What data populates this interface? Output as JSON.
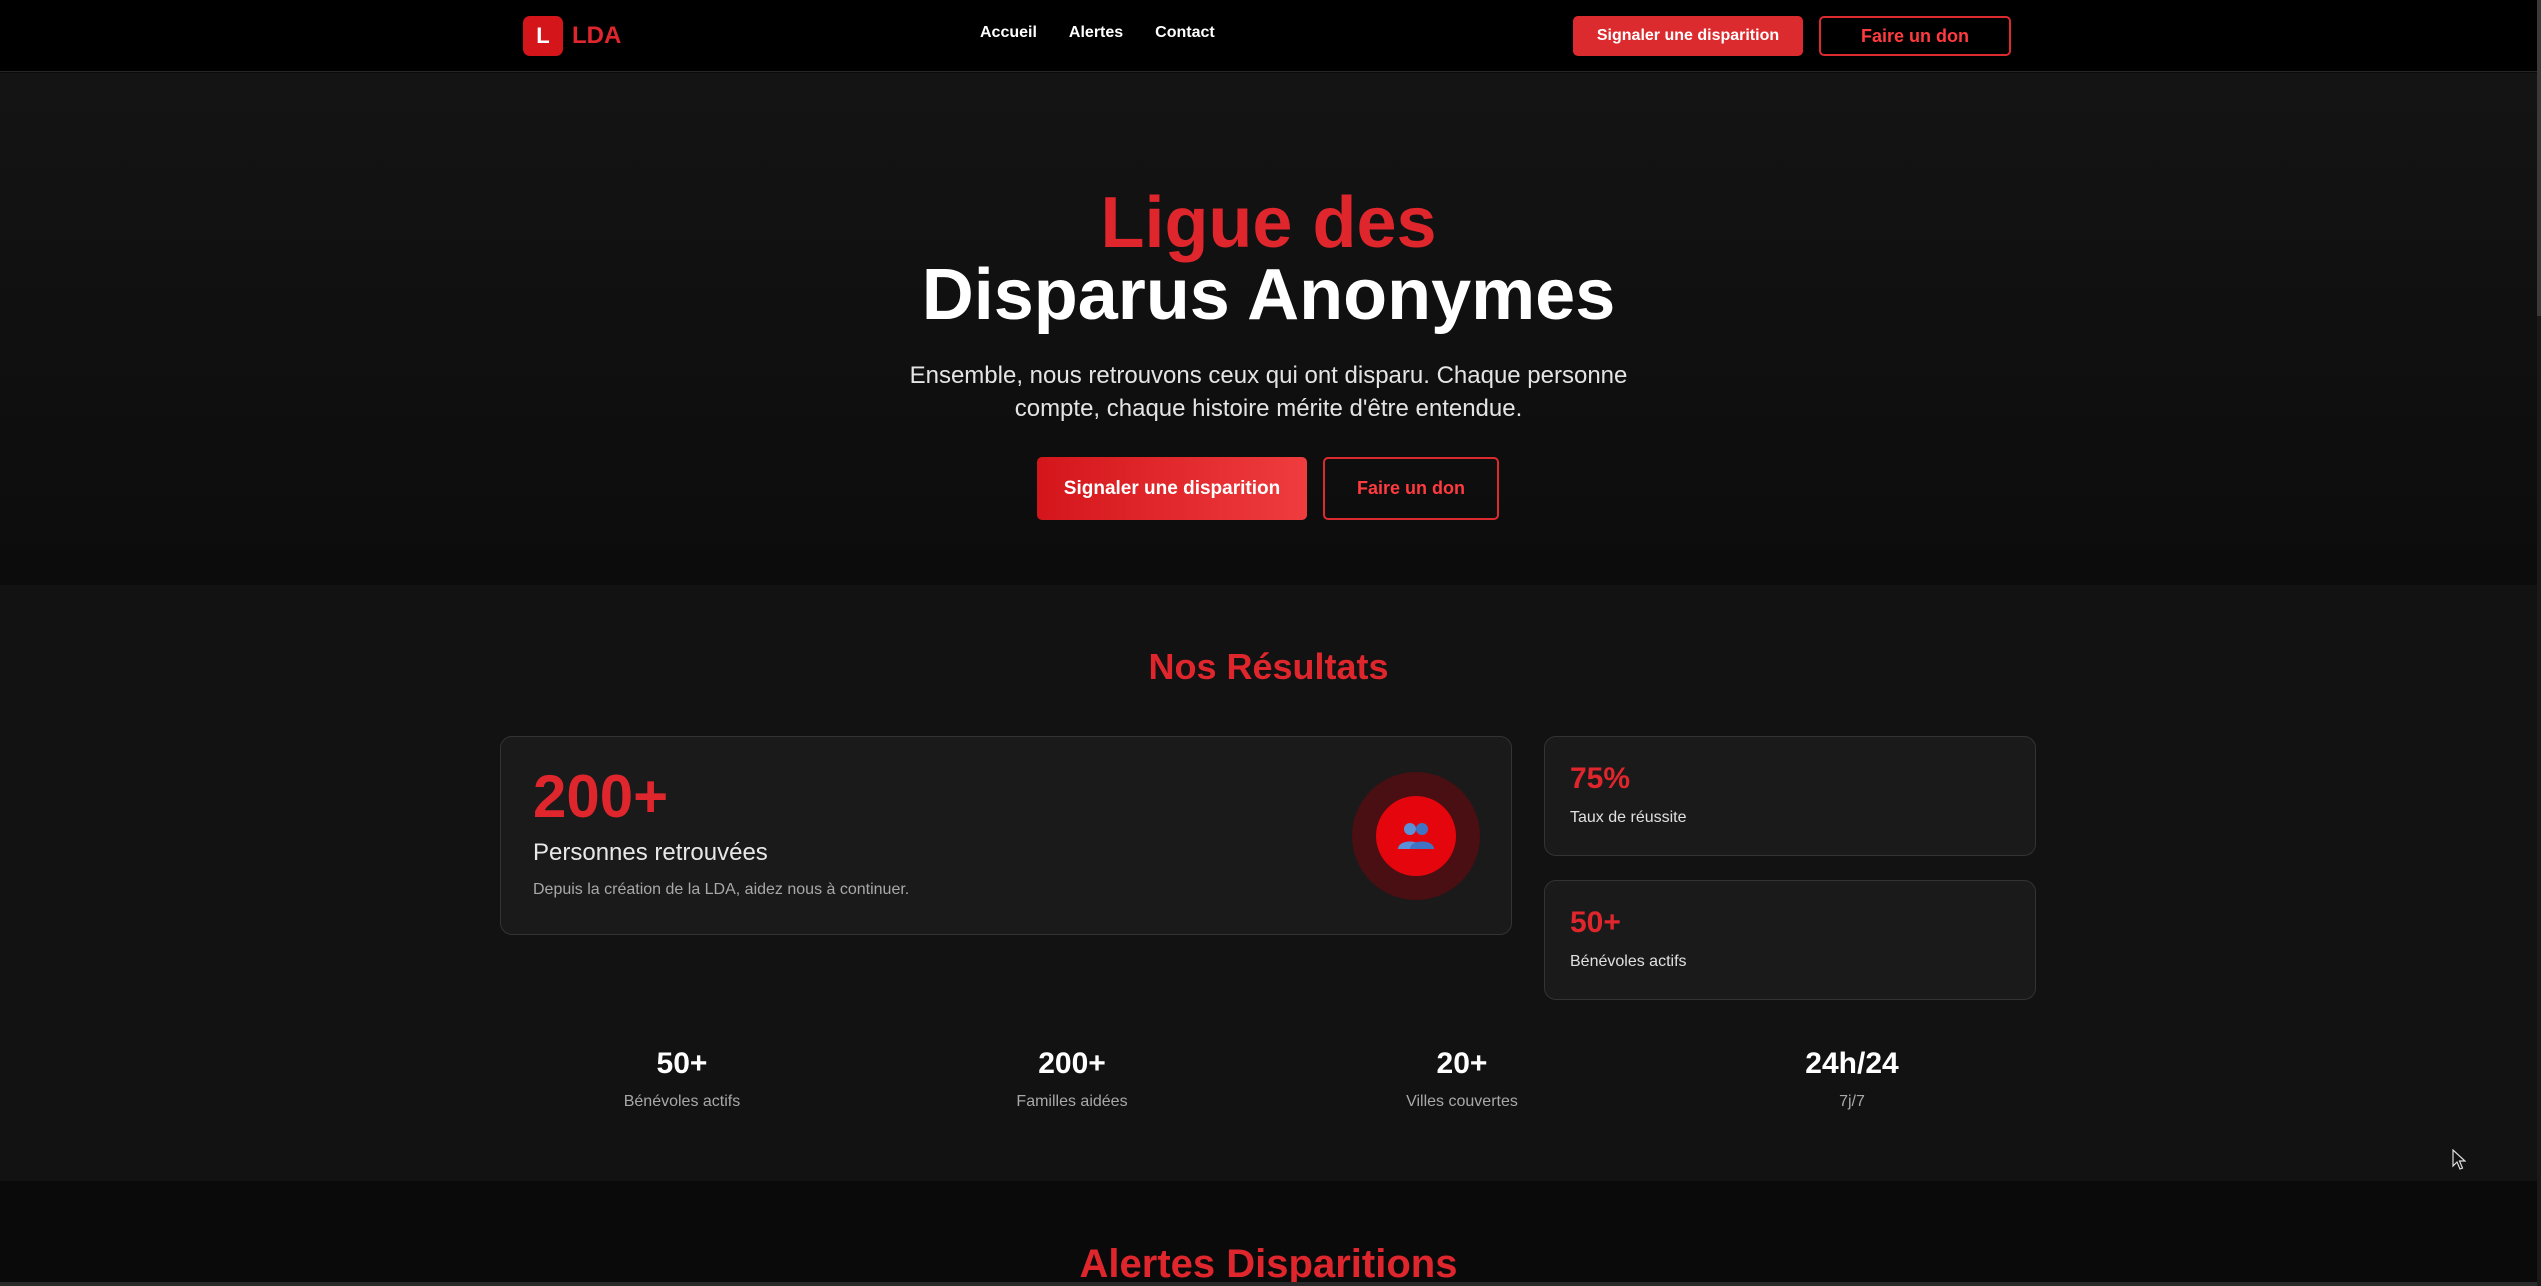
{
  "nav": {
    "logo_letter": "L",
    "logo_text": "LDA",
    "links": [
      "Accueil",
      "Alertes",
      "Contact"
    ],
    "report_button": "Signaler une disparition",
    "donate_button": "Faire un don"
  },
  "hero": {
    "title_line1": "Ligue des",
    "title_line2": "Disparus Anonymes",
    "subtitle": "Ensemble, nous retrouvons ceux qui ont disparu. Chaque personne compte, chaque histoire mérite d'être entendue.",
    "report_button": "Signaler une disparition",
    "donate_button": "Faire un don"
  },
  "results": {
    "title": "Nos Résultats",
    "main_card": {
      "value": "200+",
      "label": "Personnes retrouvées",
      "description": "Depuis la création de la LDA, aidez nous à continuer.",
      "icon": "people-icon"
    },
    "side_cards": [
      {
        "value": "75%",
        "label": "Taux de réussite"
      },
      {
        "value": "50+",
        "label": "Bénévoles actifs"
      }
    ],
    "stats": [
      {
        "value": "50+",
        "label": "Bénévoles actifs"
      },
      {
        "value": "200+",
        "label": "Familles aidées"
      },
      {
        "value": "20+",
        "label": "Villes couvertes"
      },
      {
        "value": "24h/24",
        "label": "7j/7"
      }
    ]
  },
  "alerts": {
    "title": "Alertes Disparitions"
  },
  "colors": {
    "accent": "#e0262d",
    "background": "#0b0b0b",
    "card": "#1a1a1a"
  }
}
